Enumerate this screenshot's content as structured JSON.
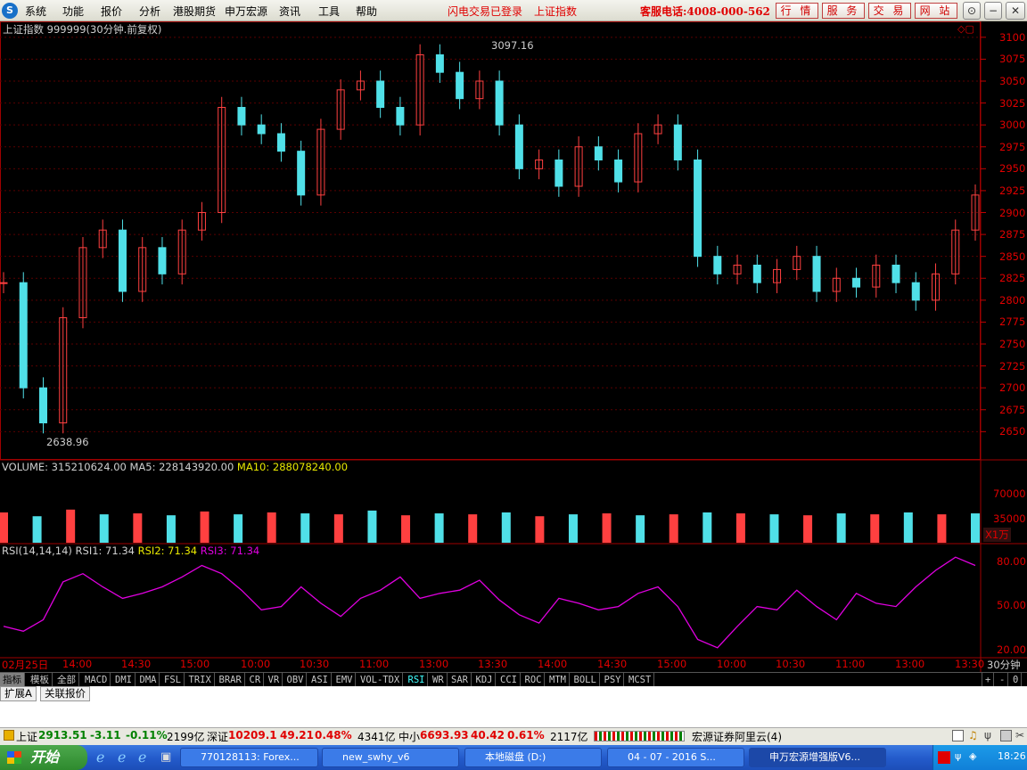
{
  "menubar": {
    "items": [
      "系统",
      "功能",
      "报价",
      "分析",
      "港股期货",
      "申万宏源",
      "资讯",
      "工具",
      "帮助"
    ],
    "flash_login": "闪电交易已登录",
    "index_name": "上证指数",
    "service_phone": "客服电话:4008-000-562",
    "right_buttons": [
      "行 情",
      "服 务",
      "交 易",
      "网 站"
    ],
    "window_buttons": [
      "⊙",
      "−",
      "❐",
      "✕"
    ]
  },
  "main_chart": {
    "title": "上证指数 999999(30分钟.前复权)",
    "high_label": "3097.16",
    "low_label": "2638.96",
    "y_ticks": [
      "3100",
      "3075",
      "3050",
      "3025",
      "3000",
      "2975",
      "2950",
      "2925",
      "2900",
      "2875",
      "2850",
      "2825",
      "2800",
      "2775",
      "2750",
      "2725",
      "2700",
      "2675",
      "2650"
    ]
  },
  "volume": {
    "label": "VOLUME: 315210624.00",
    "ma5": "MA5: 228143920.00",
    "ma10": "MA10: 288078240.00",
    "y_ticks": [
      "70000",
      "35000"
    ],
    "unit": "X1万"
  },
  "rsi": {
    "label": "RSI(14,14,14)",
    "rsi1": "RSI1: 71.34",
    "rsi2": "RSI2: 71.34",
    "rsi3": "RSI3: 71.34",
    "y_ticks": [
      "80.00",
      "50.00",
      "20.00"
    ]
  },
  "x_axis": {
    "labels": [
      "02月25日",
      "14:00",
      "14:30",
      "15:00",
      "10:00",
      "10:30",
      "11:00",
      "13:00",
      "13:30",
      "14:00",
      "14:30",
      "15:00",
      "10:00",
      "10:30",
      "11:00",
      "13:00",
      "13:30"
    ],
    "period": "30分钟"
  },
  "tools": {
    "tabs": [
      "指标",
      "模板",
      "全部"
    ],
    "indicators": [
      "MACD",
      "DMI",
      "DMA",
      "FSL",
      "TRIX",
      "BRAR",
      "CR",
      "VR",
      "OBV",
      "ASI",
      "EMV",
      "VOL-TDX",
      "RSI",
      "WR",
      "SAR",
      "KDJ",
      "CCI",
      "ROC",
      "MTM",
      "BOLL",
      "PSY",
      "MCST"
    ],
    "active": "RSI",
    "zoom": [
      "+",
      "-",
      "0"
    ]
  },
  "subtabs": [
    "扩展A",
    "关联报价"
  ],
  "status_bar": {
    "sh_name": "上证",
    "sh_val": "2913.51",
    "sh_chg": "-3.11",
    "sh_pct": "-0.11%",
    "sh_amt": "2199亿",
    "sz_name": "深证",
    "sz_val": "10209.1",
    "sz_chg": "49.21",
    "sz_pct": "0.48%",
    "sz_amt": "4341亿",
    "zx_name": "中小",
    "zx_val": "6693.93",
    "zx_chg": "40.42",
    "zx_pct": "0.61%",
    "zx_amt": "2117亿",
    "broker": "宏源证券阿里云(4)"
  },
  "taskbar": {
    "start": "开始",
    "tasks": [
      "770128113: Forex...",
      "new_swhy_v6",
      "本地磁盘 (D:)",
      "04 - 07 - 2016 S...",
      "申万宏源增强版V6..."
    ],
    "clock": "18:26"
  },
  "chart_data": [
    {
      "type": "candlestick",
      "title": "上证指数 999999(30分钟.前复权)",
      "ylim": [
        2630,
        3110
      ],
      "annotations": {
        "high": 3097.16,
        "low": 2638.96,
        "last": 2913.51
      },
      "x": [
        "02月25日",
        "14:00",
        "14:30",
        "15:00",
        "10:00",
        "10:30",
        "11:00",
        "13:00",
        "13:30",
        "14:00",
        "14:30",
        "15:00",
        "10:00",
        "10:30",
        "11:00",
        "13:00",
        "13:30"
      ],
      "close": [
        2820,
        2700,
        2660,
        2780,
        2860,
        2880,
        2810,
        2860,
        2830,
        2880,
        2900,
        3020,
        3000,
        2990,
        2970,
        2920,
        2995,
        3040,
        3050,
        3020,
        3000,
        3080,
        3060,
        3030,
        3050,
        3000,
        2950,
        2960,
        2930,
        2975,
        2960,
        2935,
        2990,
        3000,
        2960,
        2850,
        2830,
        2840,
        2820,
        2835,
        2850,
        2810,
        2825,
        2815,
        2840,
        2820,
        2800,
        2830,
        2880,
        2920
      ]
    },
    {
      "type": "bar",
      "title": "VOLUME",
      "ylim": [
        0,
        80000
      ],
      "values": [
        32000,
        28000,
        35000,
        30000,
        31000,
        29000,
        33000,
        30000,
        32000,
        31000,
        30000,
        34000,
        29000,
        31000,
        30000,
        32000,
        28000,
        30000,
        31000,
        29000,
        30000,
        32000,
        31000,
        30000,
        29000,
        31000,
        30000,
        32000,
        30000,
        31000
      ]
    },
    {
      "type": "line",
      "title": "RSI(14,14,14)",
      "ylim": [
        20,
        85
      ],
      "series": [
        {
          "name": "RSI3",
          "values": [
            38,
            35,
            42,
            65,
            70,
            62,
            55,
            58,
            62,
            68,
            75,
            70,
            60,
            48,
            50,
            62,
            52,
            44,
            55,
            60,
            68,
            55,
            58,
            60,
            66,
            54,
            45,
            40,
            55,
            52,
            48,
            50,
            58,
            62,
            50,
            30,
            25,
            38,
            50,
            48,
            60,
            50,
            42,
            58,
            52,
            50,
            62,
            72,
            80,
            75
          ]
        }
      ]
    }
  ]
}
